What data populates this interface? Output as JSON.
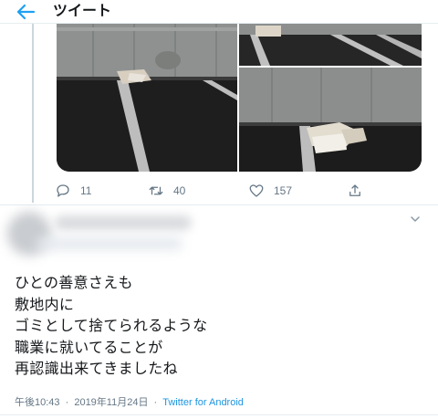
{
  "header": {
    "title": "ツイート",
    "back_icon": "arrow-left-icon"
  },
  "colors": {
    "accent": "#1da1f2",
    "text": "#14171a",
    "muted": "#657786",
    "border": "#e6ecf0"
  },
  "actions": {
    "replies": "11",
    "retweets": "40",
    "likes": "157"
  },
  "tweet": {
    "lines": [
      "ひとの善意さえも",
      "敷地内に",
      "ゴミとして捨てられるような",
      "職業に就いてることが",
      "再認識出来てきましたね"
    ],
    "time": "午後10:43",
    "separator": "·",
    "date": "2019年11月24日",
    "source": "Twitter for Android"
  }
}
